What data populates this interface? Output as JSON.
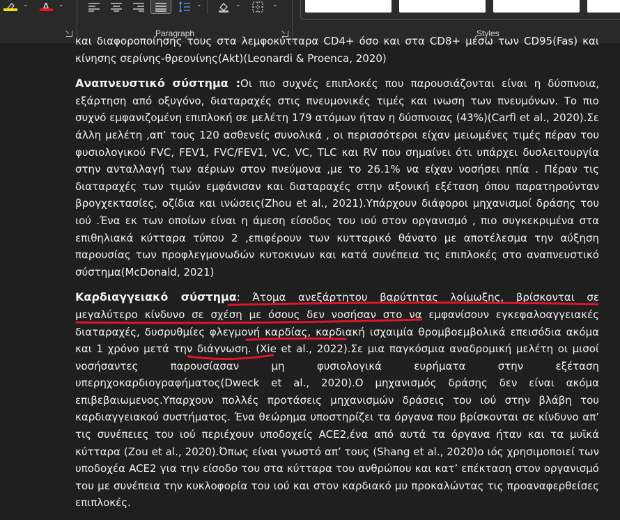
{
  "ribbon": {
    "highlight_icon": "highlighter-icon",
    "highlight_color": "#f5e400",
    "font_color_glyph": "A",
    "font_color_swatch": "#e81123",
    "paragraph_label": "Paragraph",
    "styles_label": "Styles"
  },
  "document": {
    "p1": "και διαφοροποίησης τους στα λεμφοκύτταρα CD4+ όσο και στα CD8+ μέσω των CD95(Fas) και κίνησης σερίνης-θρεονίνης(Akt)(Leonardi & Proenca, 2020)",
    "p2_head": "Αναπνευστικό σύστημα :",
    "p2_body": "Οι πιο συχνές επιπλοκές που παρουσιάζονται είναι η δύσπνοια, εξάρτηση από οξυγόνο, διαταραχές στις πνευμονικές τιμές και ινωση των πνευμόνων. Το πιο συχνό εμφανιζομένη επιπλοκή σε μελέτη 179 ατόμων ήταν η δύσπνοιας (43%)(Carfì et al., 2020).Σε άλλη μελέτη ,απ’ τους 120 ασθενείς συνολικά , οι περισσότεροι είχαν μειωμένες τιμές πέραν του φυσιολογικού FVC, FEV1, FVC/FEV1, VC, VC, TLC και RV που σημαίνει ότι υπάρχει δυσλειτουργία στην ανταλλαγή των αέριων στον πνεύμονα ,με το 26.1% να είχαν νοσήσει ηπία . Πέραν τις διαταραχές των τιμών εμφάνισαν και διαταραχές στην αξονική εξέταση όπου παρατηρούνταν βρογχεκτασίες, οζίδια και ινώσεις(Zhou et al., 2021).Υπάρχουν διάφοροι μηχανισμοί δράσης του ιού .Ένα εκ των οποίων είναι η άμεση είσοδος του ιού στον οργανισμό , πιο συγκεκριμένα στα επιθηλιακά κύτταρα τύπου 2 ,επιφέρουν των κυτταρικό θάνατο με αποτέλεσμα την αύξηση παρουσίας των προφλεγμονωδών κυτοκινων και κατά συνέπεια τις επιπλοκές στο αναπνευστικό σύστημα(McDonald, 2021)",
    "p3_head": "Καρδιαγγειακό σύστημα",
    "p3_colon": ": ",
    "p3_u1": "Άτομα ανεξάρτητου βαρύτητας λοίμωξης, βρίσκονται σε μεγαλύτερο κίνδυνο σε σχέση με όσους δεν νοσήσαν στο να εμφανίσουν",
    "p3_t1": " εγκεφαλοαγγειακές διαταραχές, δυσρυθμίες φλεγμονή καρδίας, ",
    "p3_u2": "καρδιακή ισχαιμία",
    "p3_t2": " θρομβοεμβολικά επεισόδια ακόμα και 1 χρόνο μετά την διάγνωση. ",
    "p3_u3": "(Xie et al., 2022)",
    "p3_t3": ".Σε μια παγκόσμια αναδρομική μελέτη οι μισοί νοσήσαντες παρουσίασαν μη φυσιολογικά ευρήματα στην εξέταση υπερηχοκαρδιογραφήματος(Dweck et al., 2020).Ο μηχανισμός δράσης δεν είναι ακόμα επιβεβαιωμενος.Υπαρχουν πολλές προτάσεις μηχανισμών δράσεις του ιού στην βλάβη του καρδιαγγειακού συστήματος. Ένα θεώρημα υποστηρίζει τα όργανα που βρίσκονται σε κίνδυνο απ’ τις συνέπειες του ιού περιέχουν υποδοχείς ACE2,ένα από αυτά τα όργανα ήταν και τα μυϊκά κύτταρα (Zou et al., 2020).Όπως είναι γνωστό απ’ τους (Shang et al., 2020)ο ιός χρησιμοποιεί των υποδοχέα ACE2 για την είσοδο του στα κύτταρα του ανθρώπου και κατ’ επέκταση στον οργανισμό του με συνέπεια την κυκλοφορία του ιού και στον καρδιακό μυ προκαλώντας τις προαναφερθείσες επιπλοκές."
  },
  "annotation_color": "#e0142a"
}
